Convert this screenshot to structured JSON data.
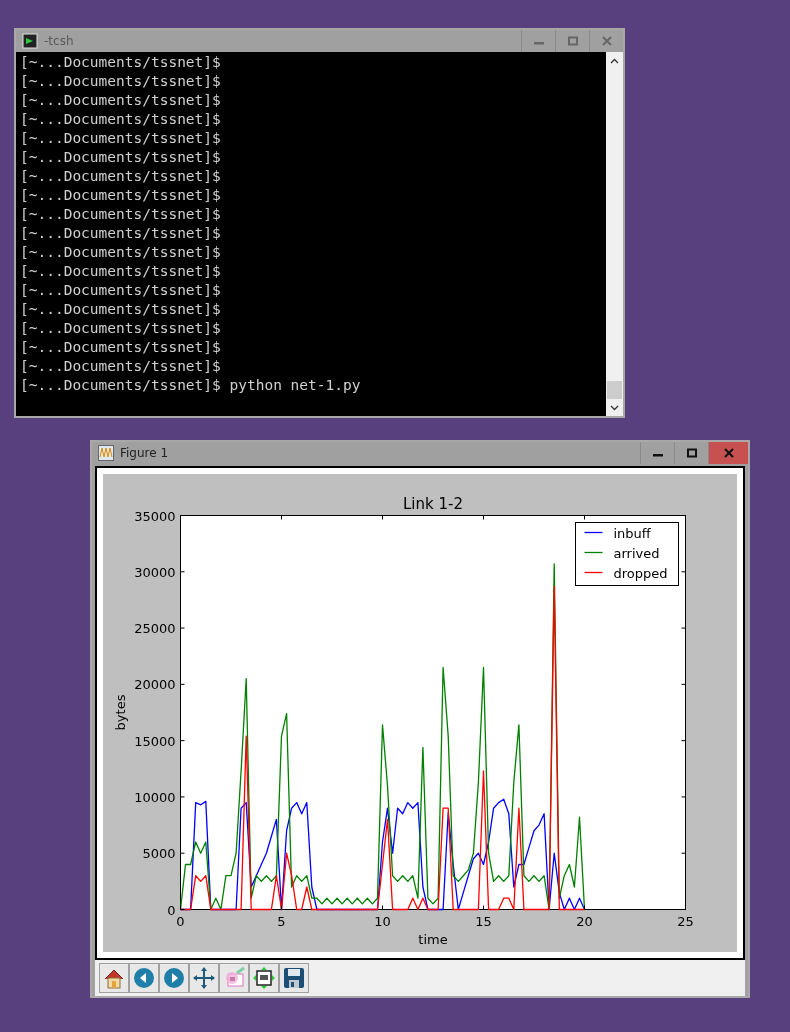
{
  "terminal": {
    "title": "-tcsh",
    "lines": [
      "[~...Documents/tssnet]$",
      "[~...Documents/tssnet]$",
      "[~...Documents/tssnet]$",
      "[~...Documents/tssnet]$",
      "[~...Documents/tssnet]$",
      "[~...Documents/tssnet]$",
      "[~...Documents/tssnet]$",
      "[~...Documents/tssnet]$",
      "[~...Documents/tssnet]$",
      "[~...Documents/tssnet]$",
      "[~...Documents/tssnet]$",
      "[~...Documents/tssnet]$",
      "[~...Documents/tssnet]$",
      "[~...Documents/tssnet]$",
      "[~...Documents/tssnet]$",
      "[~...Documents/tssnet]$",
      "[~...Documents/tssnet]$",
      "[~...Documents/tssnet]$ python net-1.py"
    ]
  },
  "figure_window": {
    "title": "Figure 1",
    "chart_data": {
      "type": "line",
      "title": "Link 1-2",
      "xlabel": "time",
      "ylabel": "bytes",
      "x": [
        0,
        0.25,
        0.5,
        0.75,
        1,
        1.25,
        1.5,
        1.75,
        2,
        2.25,
        2.5,
        2.75,
        3,
        3.25,
        3.5,
        3.75,
        4,
        4.25,
        4.5,
        4.75,
        5,
        5.25,
        5.5,
        5.75,
        6,
        6.25,
        6.5,
        6.75,
        7,
        7.25,
        7.5,
        7.75,
        8,
        8.25,
        8.5,
        8.75,
        9,
        9.25,
        9.5,
        9.75,
        10,
        10.25,
        10.5,
        10.75,
        11,
        11.25,
        11.5,
        11.75,
        12,
        12.25,
        12.5,
        12.75,
        13,
        13.25,
        13.5,
        13.75,
        14,
        14.25,
        14.5,
        14.75,
        15,
        15.25,
        15.5,
        15.75,
        16,
        16.25,
        16.5,
        16.75,
        17,
        17.25,
        17.5,
        17.75,
        18,
        18.25,
        18.5,
        18.75,
        19,
        19.25,
        19.5,
        19.75,
        20
      ],
      "series": [
        {
          "name": "inbuff",
          "color": "#0000ff",
          "values": [
            0,
            0,
            0,
            9500,
            9300,
            9600,
            0,
            0,
            0,
            0,
            0,
            0,
            9000,
            9500,
            2000,
            3000,
            4000,
            5000,
            6500,
            8000,
            0,
            7000,
            9000,
            9500,
            8500,
            9500,
            2000,
            0,
            0,
            0,
            0,
            0,
            0,
            0,
            0,
            0,
            0,
            0,
            0,
            0,
            6000,
            9000,
            5000,
            9000,
            8500,
            9500,
            9000,
            9500,
            2000,
            0,
            0,
            0,
            0,
            8600,
            4000,
            0,
            1500,
            3000,
            4500,
            5000,
            4000,
            6000,
            9000,
            9500,
            9800,
            8500,
            2000,
            4000,
            4000,
            5500,
            7000,
            7500,
            8500,
            0,
            5000,
            1500,
            0,
            1000,
            0,
            1000,
            0
          ]
        },
        {
          "name": "arrived",
          "color": "#008000",
          "values": [
            0,
            4000,
            4000,
            6000,
            5000,
            6000,
            0,
            1000,
            0,
            3000,
            3000,
            5000,
            12300,
            20500,
            1000,
            3000,
            2500,
            3000,
            2500,
            3000,
            15400,
            17400,
            2000,
            3000,
            2500,
            3000,
            1000,
            1000,
            500,
            1000,
            500,
            1000,
            500,
            1000,
            500,
            1000,
            500,
            1000,
            500,
            1000,
            16400,
            11000,
            3000,
            2500,
            3000,
            2500,
            3000,
            1000,
            14400,
            1000,
            500,
            1000,
            21500,
            15400,
            3000,
            2500,
            3000,
            3500,
            5000,
            11300,
            21500,
            5000,
            2500,
            3000,
            2500,
            3000,
            11300,
            16400,
            3000,
            2500,
            3000,
            2500,
            3000,
            0,
            30700,
            1000,
            3000,
            4000,
            2000,
            8200,
            0
          ]
        },
        {
          "name": "dropped",
          "color": "#ff0000",
          "values": [
            0,
            0,
            0,
            3000,
            2500,
            3000,
            0,
            0,
            0,
            0,
            0,
            0,
            0,
            15400,
            0,
            0,
            0,
            0,
            0,
            3000,
            0,
            5000,
            3000,
            0,
            0,
            2000,
            0,
            0,
            0,
            0,
            0,
            0,
            0,
            0,
            0,
            0,
            0,
            0,
            0,
            0,
            4000,
            8000,
            0,
            0,
            0,
            0,
            1000,
            0,
            1000,
            0,
            0,
            0,
            9000,
            9000,
            0,
            0,
            0,
            0,
            0,
            0,
            12300,
            0,
            0,
            0,
            1000,
            1000,
            0,
            9000,
            0,
            0,
            0,
            0,
            0,
            0,
            28700,
            0,
            0,
            0,
            0,
            0,
            0
          ]
        }
      ],
      "legend": true,
      "xlim": [
        0,
        25
      ],
      "ylim": [
        0,
        35000
      ],
      "xticks": [
        0,
        5,
        10,
        15,
        20,
        25
      ],
      "yticks": [
        0,
        5000,
        10000,
        15000,
        20000,
        25000,
        30000,
        35000
      ]
    }
  }
}
